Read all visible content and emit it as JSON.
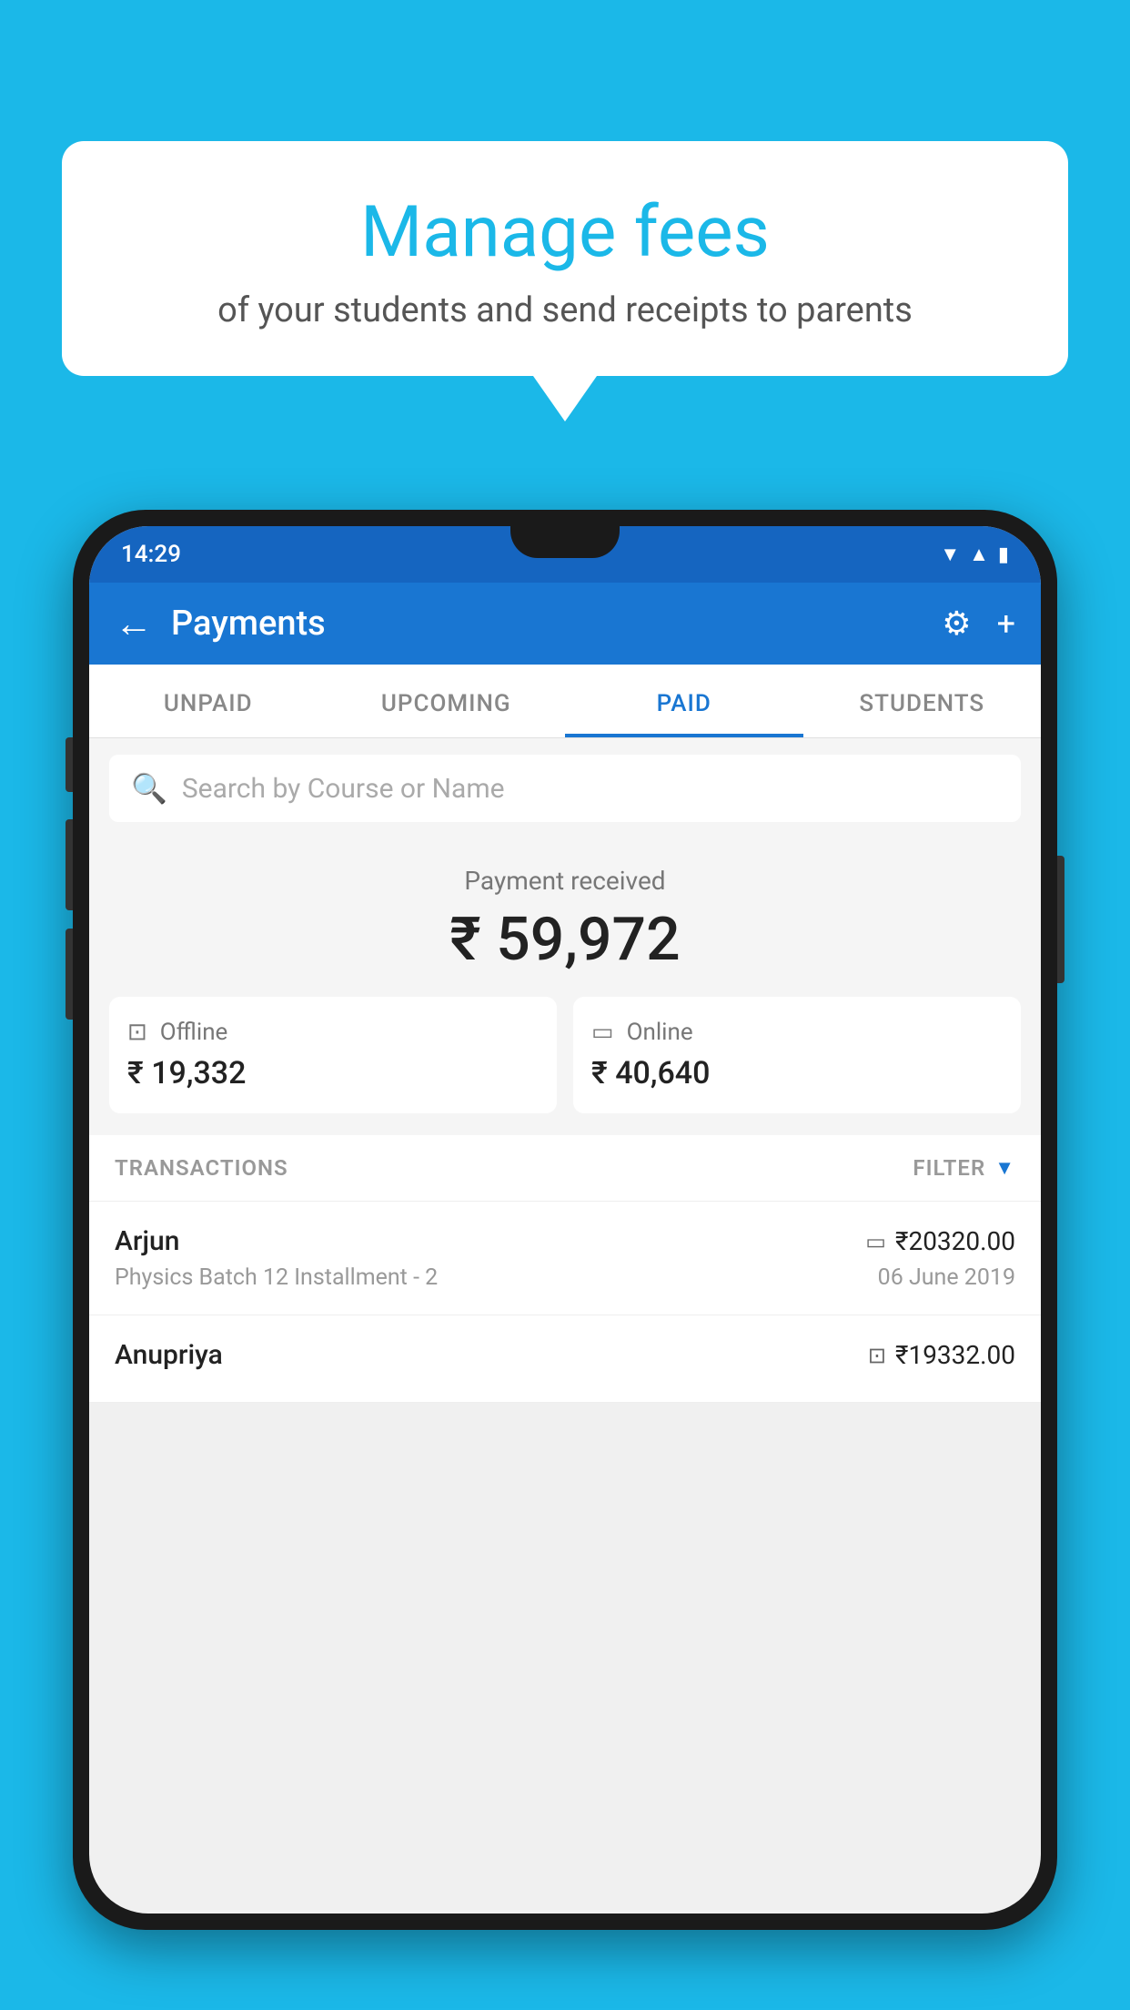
{
  "background_color": "#1BB8E8",
  "speech_bubble": {
    "title": "Manage fees",
    "subtitle": "of your students and send receipts to parents"
  },
  "phone": {
    "status_bar": {
      "time": "14:29",
      "icons": [
        "wifi",
        "signal",
        "battery"
      ]
    },
    "app_bar": {
      "title": "Payments",
      "back_label": "←",
      "settings_label": "⚙",
      "add_label": "+"
    },
    "tabs": [
      {
        "label": "UNPAID",
        "active": false
      },
      {
        "label": "UPCOMING",
        "active": false
      },
      {
        "label": "PAID",
        "active": true
      },
      {
        "label": "STUDENTS",
        "active": false
      }
    ],
    "search": {
      "placeholder": "Search by Course or Name"
    },
    "payment_summary": {
      "label": "Payment received",
      "amount": "₹ 59,972",
      "offline": {
        "label": "Offline",
        "amount": "₹ 19,332"
      },
      "online": {
        "label": "Online",
        "amount": "₹ 40,640"
      }
    },
    "transactions": {
      "label": "TRANSACTIONS",
      "filter_label": "FILTER",
      "rows": [
        {
          "name": "Arjun",
          "amount": "₹20320.00",
          "course": "Physics Batch 12 Installment - 2",
          "date": "06 June 2019",
          "payment_type": "online"
        },
        {
          "name": "Anupriya",
          "amount": "₹19332.00",
          "course": "",
          "date": "",
          "payment_type": "offline"
        }
      ]
    }
  }
}
